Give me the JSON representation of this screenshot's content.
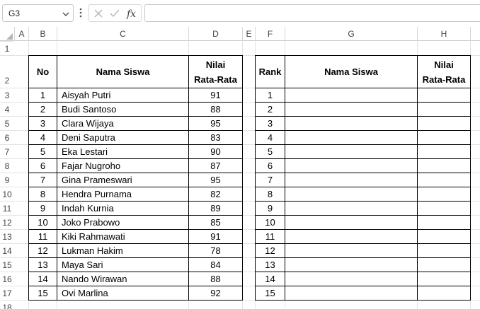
{
  "formula_bar": {
    "name_box": "G3",
    "formula": ""
  },
  "columns": [
    "A",
    "B",
    "C",
    "D",
    "E",
    "F",
    "G",
    "H"
  ],
  "rows": [
    "1",
    "2",
    "3",
    "4",
    "5",
    "6",
    "7",
    "8",
    "9",
    "10",
    "11",
    "12",
    "13",
    "14",
    "15",
    "16",
    "17",
    "18"
  ],
  "left_table": {
    "headers": {
      "no": "No",
      "name": "Nama Siswa",
      "score_line1": "Nilai",
      "score_line2": "Rata-Rata"
    },
    "rows": [
      {
        "no": "1",
        "name": "Aisyah Putri",
        "score": "91"
      },
      {
        "no": "2",
        "name": "Budi Santoso",
        "score": "88"
      },
      {
        "no": "3",
        "name": "Clara Wijaya",
        "score": "95"
      },
      {
        "no": "4",
        "name": "Deni Saputra",
        "score": "83"
      },
      {
        "no": "5",
        "name": "Eka Lestari",
        "score": "90"
      },
      {
        "no": "6",
        "name": "Fajar Nugroho",
        "score": "87"
      },
      {
        "no": "7",
        "name": "Gina Prameswari",
        "score": "95"
      },
      {
        "no": "8",
        "name": "Hendra Purnama",
        "score": "82"
      },
      {
        "no": "9",
        "name": "Indah Kurnia",
        "score": "89"
      },
      {
        "no": "10",
        "name": "Joko Prabowo",
        "score": "85"
      },
      {
        "no": "11",
        "name": "Kiki Rahmawati",
        "score": "91"
      },
      {
        "no": "12",
        "name": "Lukman Hakim",
        "score": "78"
      },
      {
        "no": "13",
        "name": "Maya Sari",
        "score": "84"
      },
      {
        "no": "14",
        "name": "Nando Wirawan",
        "score": "88"
      },
      {
        "no": "15",
        "name": "Ovi Marlina",
        "score": "92"
      }
    ]
  },
  "right_table": {
    "headers": {
      "rank": "Rank",
      "name": "Nama Siswa",
      "score_line1": "Nilai",
      "score_line2": "Rata-Rata"
    },
    "ranks": [
      "1",
      "2",
      "3",
      "4",
      "5",
      "6",
      "7",
      "8",
      "9",
      "10",
      "11",
      "12",
      "13",
      "14",
      "15"
    ]
  },
  "icons": {
    "name_box_dropdown": "chevron-down-icon",
    "more": "vertical-dots-icon",
    "cancel": "x-icon",
    "enter": "check-icon",
    "function": "fx-icon"
  },
  "colors": {
    "selection": "#107c41",
    "gridline": "#e3e3e3",
    "header_text": "#444444"
  }
}
